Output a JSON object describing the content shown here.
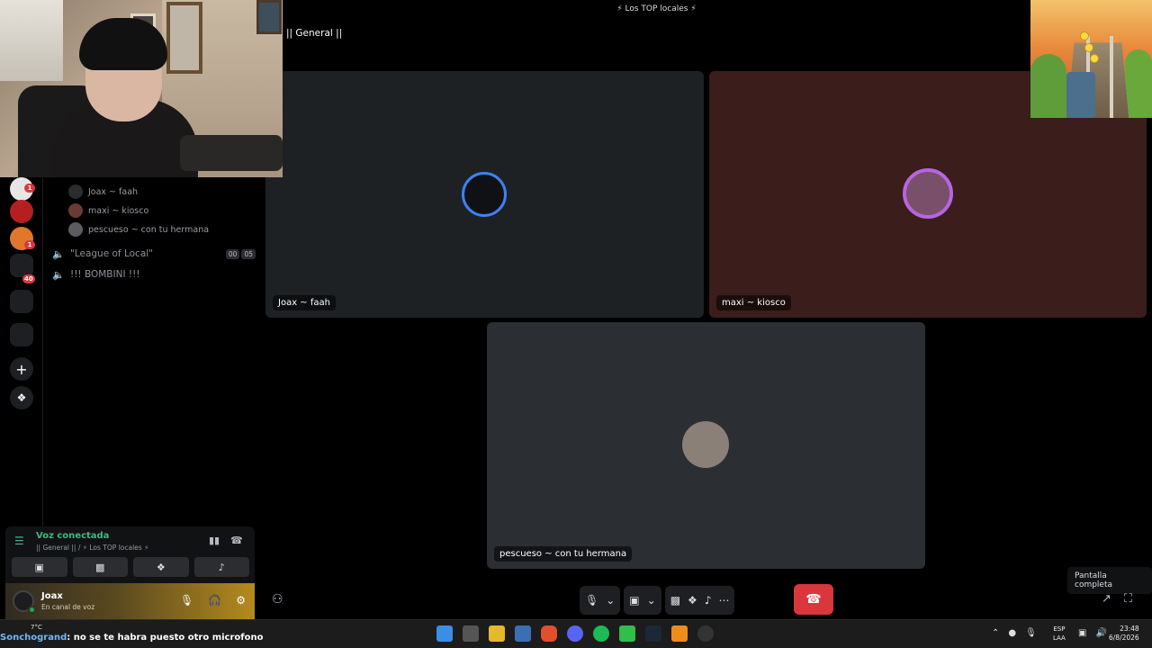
{
  "window": {
    "title": "Los TOP locales",
    "channel_header": "|| General ||"
  },
  "voice_channel_members": [
    {
      "name": "Joax ~ faah"
    },
    {
      "name": "maxi ~ kiosco"
    },
    {
      "name": "pescueso ~ con tu hermana"
    }
  ],
  "voice_channels": [
    {
      "name": "\"League of Local\"",
      "timer": [
        "00",
        "05"
      ]
    },
    {
      "name": "!!! BOMBINI !!!"
    }
  ],
  "server_badges": [
    "1",
    "1",
    "40"
  ],
  "voice_panel": {
    "status": "Voz conectada",
    "location": "|| General || / ⚡ Los TOP locales ⚡"
  },
  "user_panel": {
    "name": "Joax",
    "status": "En canal de voz"
  },
  "stage": {
    "tiles": [
      {
        "label": "Joax ~ faah"
      },
      {
        "label": "maxi ~ kiosco"
      },
      {
        "label": "pescueso ~ con tu hermana"
      }
    ]
  },
  "tooltip": "Pantalla completa",
  "taskbar": {
    "news_name": "Sonchogrand",
    "news_text": ": no se te habra puesto otro microfono",
    "weather": "7°C",
    "lang_line1": "ESP",
    "lang_line2": "LAA",
    "time": "23:48",
    "date": "6/8/2026"
  },
  "colors": {
    "accent_green": "#43b581",
    "end_call_red": "#da373c",
    "tile_dark": "#1e2124",
    "tile_maroon": "#3b1d1b",
    "tile_gray": "#2b2e33"
  }
}
